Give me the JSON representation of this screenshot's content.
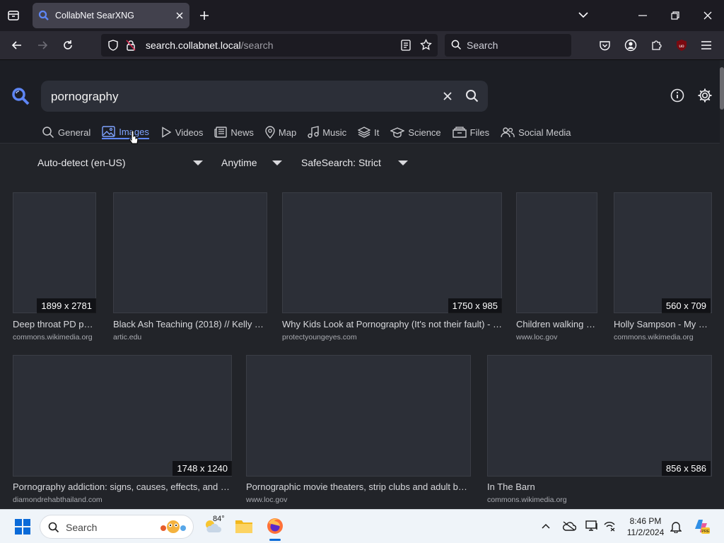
{
  "browser": {
    "tab_title": "CollabNet SearXNG",
    "url_domain": "search.collabnet.local",
    "url_path": "/search",
    "search_placeholder": "Search",
    "extension_badge": "uo"
  },
  "searx": {
    "query": "pornography",
    "categories": [
      {
        "label": "General",
        "icon": "search-icon"
      },
      {
        "label": "Images",
        "icon": "image-icon",
        "active": true
      },
      {
        "label": "Videos",
        "icon": "play-icon"
      },
      {
        "label": "News",
        "icon": "newspaper-icon"
      },
      {
        "label": "Map",
        "icon": "map-pin-icon"
      },
      {
        "label": "Music",
        "icon": "music-icon"
      },
      {
        "label": "It",
        "icon": "layers-icon"
      },
      {
        "label": "Science",
        "icon": "science-icon"
      },
      {
        "label": "Files",
        "icon": "files-icon"
      },
      {
        "label": "Social Media",
        "icon": "people-icon"
      }
    ],
    "filters": {
      "language": "Auto-detect (en-US)",
      "time": "Anytime",
      "safesearch": "SafeSearch: Strict"
    },
    "results": [
      {
        "title": "Deep throat PD po…",
        "url": "commons.wikimedia.org",
        "resolution": "1899 x 2781"
      },
      {
        "title": "Black Ash Teaching (2018) // Kelly …",
        "url": "artic.edu",
        "resolution": ""
      },
      {
        "title": "Why Kids Look at Pornography (It's not their fault) - …",
        "url": "protectyoungeyes.com",
        "resolution": "1750 x 985"
      },
      {
        "title": "Children walking …",
        "url": "www.loc.gov",
        "resolution": ""
      },
      {
        "title": "Holly Sampson - My …",
        "url": "commons.wikimedia.org",
        "resolution": "560 x 709"
      },
      {
        "title": "Pornography addiction: signs, causes, effects, and …",
        "url": "diamondrehabthailand.com",
        "resolution": "1748 x 1240"
      },
      {
        "title": "Pornographic movie theaters, strip clubs and adult b…",
        "url": "www.loc.gov",
        "resolution": ""
      },
      {
        "title": "In The Barn",
        "url": "commons.wikimedia.org",
        "resolution": "856 x 586"
      }
    ]
  },
  "taskbar": {
    "search_label": "Search",
    "weather_temp": "84°",
    "time": "8:46 PM",
    "date": "11/2/2024"
  },
  "colors": {
    "accent": "#5e86f5",
    "page_bg": "#222429"
  }
}
